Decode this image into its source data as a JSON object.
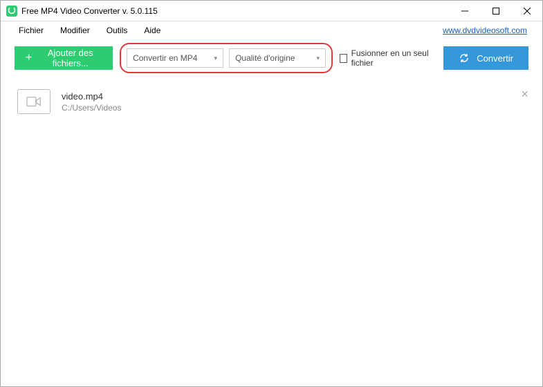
{
  "window": {
    "title": "Free MP4 Video Converter v. 5.0.115"
  },
  "menu": {
    "file": "Fichier",
    "edit": "Modifier",
    "tools": "Outils",
    "help": "Aide",
    "website": "www.dvdvideosoft.com"
  },
  "toolbar": {
    "add_files": "Ajouter des fichiers...",
    "format_dropdown": "Convertir en MP4",
    "quality_dropdown": "Qualité d'origine",
    "merge_label": "Fusionner en un seul fichier",
    "convert": "Convertir"
  },
  "files": [
    {
      "name": "video.mp4",
      "path": "C:/Users/Videos"
    }
  ]
}
